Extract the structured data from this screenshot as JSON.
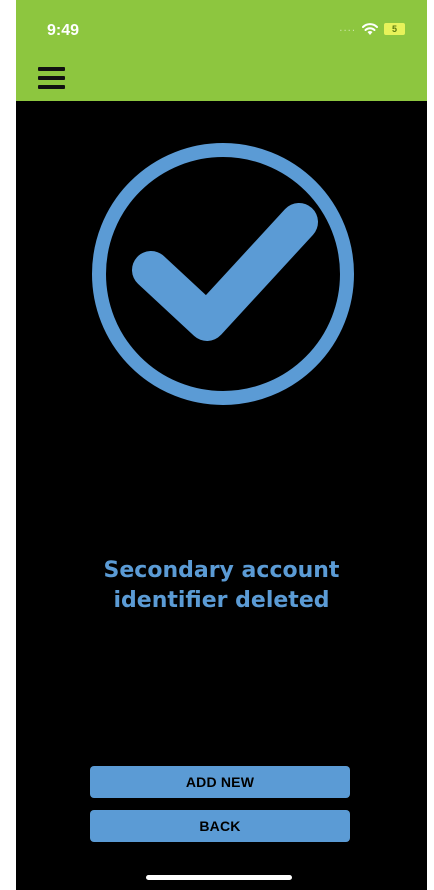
{
  "status_bar": {
    "time": "9:49",
    "signal_icon": "signal-dots-icon",
    "wifi_icon": "wifi-icon",
    "battery_level": "5",
    "battery_color": "#e7f25a"
  },
  "header": {
    "menu_icon": "hamburger-menu-icon",
    "background_color": "#8dc63f"
  },
  "main": {
    "icon": "checkmark-circle-icon",
    "icon_color": "#5b9bd5",
    "message_line1": "Secondary account",
    "message_line2": "identifier deleted"
  },
  "actions": {
    "add_new_label": "ADD NEW",
    "back_label": "BACK",
    "button_color": "#5b9bd5"
  }
}
